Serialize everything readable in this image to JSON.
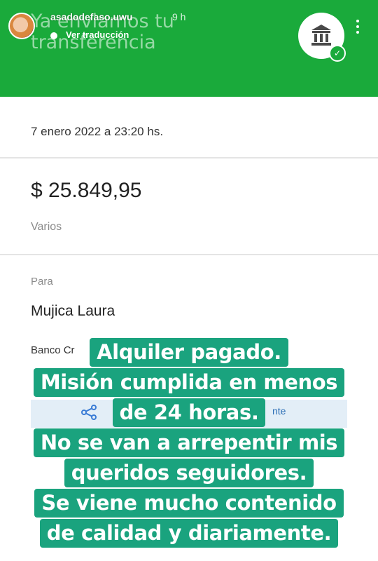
{
  "story": {
    "username": "asadodefaso.uwu",
    "time_ago": "9 h",
    "translate_label": "Ver traducción",
    "icons": {
      "bank": "bank-icon",
      "check": "check-icon",
      "more": "more-vertical-icon",
      "share": "share-icon"
    }
  },
  "header": {
    "title": "Ya enviamos tu transferencia",
    "color": "#1aaa3b"
  },
  "transfer": {
    "date": "7 enero 2022 a 23:20 hs.",
    "amount": "$ 25.849,95",
    "concept": "Varios",
    "to_label": "Para",
    "recipient": "Mujica Laura",
    "bank_partial": "Banco Cr",
    "share_suffix": "nte"
  },
  "caption": {
    "lines": [
      "Alquiler pagado.",
      "Misión cumplida en menos",
      "de 24 horas.",
      "No se van a arrepentir mis",
      "queridos seguidores.",
      "Se viene mucho contenido",
      "de calidad y diariamente."
    ],
    "background": "#1aa37e"
  }
}
